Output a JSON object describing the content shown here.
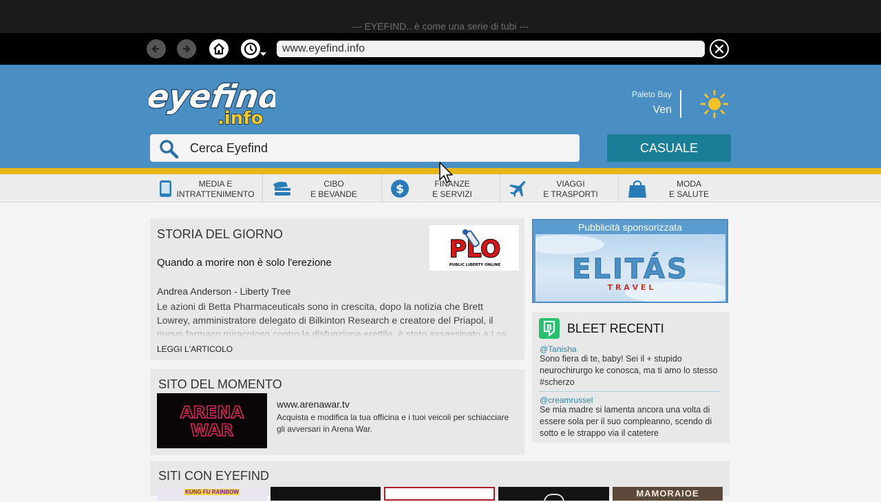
{
  "window": {
    "tagline": "--- EYEFIND.. è come una serie di tubi ---",
    "address": "www.eyefind.info"
  },
  "nav": {
    "back_icon": "arrow-left-icon",
    "forward_icon": "arrow-right-icon",
    "home_icon": "home-icon",
    "history_icon": "clock-icon",
    "close_icon": "close-icon"
  },
  "header": {
    "logo_top": "eyefind",
    "logo_bottom": ".info",
    "weather_location": "Paleto Bay",
    "weather_day": "Ven",
    "weather_icon": "sun-icon",
    "search_placeholder": "Cerca Eyefind",
    "random_button": "CASUALE"
  },
  "categories": [
    {
      "line1": "MEDIA E",
      "line2": "INTRATTENIMENTO",
      "icon": "tablet-icon"
    },
    {
      "line1": "CIBO",
      "line2": "E BEVANDE",
      "icon": "food-icon"
    },
    {
      "line1": "FINANZE",
      "line2": "E SERVIZI",
      "icon": "dollar-icon"
    },
    {
      "line1": "VIAGGI",
      "line2": "E TRASPORTI",
      "icon": "plane-icon"
    },
    {
      "line1": "MODA",
      "line2": "E SALUTE",
      "icon": "shopping-bag-icon"
    }
  ],
  "story": {
    "section_title": "STORIA DEL GIORNO",
    "headline": "Quando a morire non è solo l'erezione",
    "author": "Andrea Anderson - Liberty Tree",
    "body": "Le azioni di Betta Pharmaceuticals sono in crescita, dopo la notizia che Brett Lowrey, amministratore delegato di Bilkinton Research e creatore del Priapol, il nuovo farmaco miracoloso contro la disfunzione erettile, è stato assassinato a Los",
    "read_more": "LEGGI L'ARTICOLO",
    "logo_text": "PLO",
    "logo_subtext": "PUBLIC LIBERTY ONLINE"
  },
  "site_of_moment": {
    "section_title": "SITO DEL MOMENTO",
    "image_line1": "ARENA",
    "image_line2": "WAR",
    "url": "www.arenawar.tv",
    "description": "Acquista e modifica la tua officina e i tuoi veicoli per schiacciare gli avversari in Arena War."
  },
  "ad": {
    "label": "Pubblicità sponsorizzata",
    "brand": "ELITÁS",
    "tagline": "T R A V E L"
  },
  "bleets": {
    "title": "BLEET RECENTI",
    "items": [
      {
        "handle": "@Tanisha",
        "text": "Sono fiera di te, baby! Sei il + stupido neurochirurgo ke conosca, ma ti amo lo stesso #scherzo"
      },
      {
        "handle": "@creamrussel",
        "text": "Se mia madre si lamenta ancora una volta di essere sola per il suo compleanno, scendo di sotto e le strappo via il catetere"
      }
    ]
  },
  "sites_with_eyefind": {
    "section_title": "SITI CON EYEFIND",
    "first_thumb_label": "KUNG FU RAINBOW",
    "last_thumb_label": "MAMORAIOE"
  },
  "colors": {
    "header_blue": "#4a8fc4",
    "accent_yellow": "#e7b71a",
    "button_teal": "#1a7f96",
    "bleet_green": "#25c16f"
  }
}
